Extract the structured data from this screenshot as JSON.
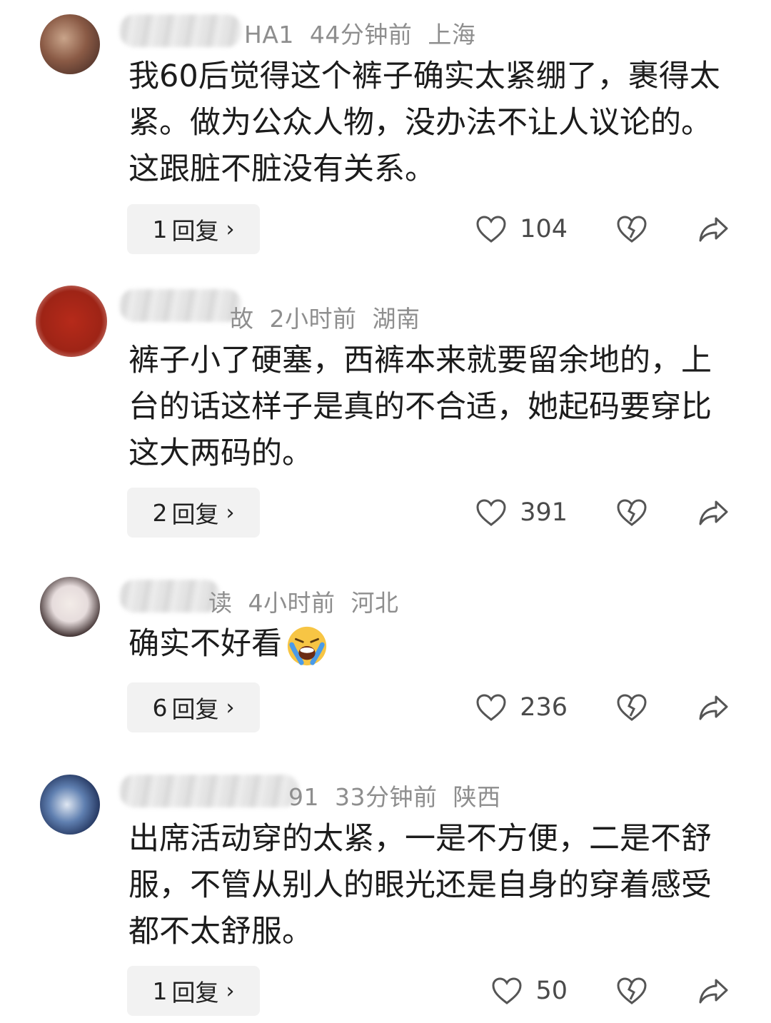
{
  "comments": [
    {
      "name_suffix": "HA1",
      "time": "44分钟前",
      "location": "上海",
      "text": "我60后觉得这个裤子确实太紧绷了，裹得太紧。做为公众人物，没办法不让人议论的。这跟脏不脏没有关系。",
      "reply_count": "1",
      "reply_label": "回复",
      "likes": "104"
    },
    {
      "name_suffix": "故",
      "time": "2小时前",
      "location": "湖南",
      "text": "裤子小了硬塞，西裤本来就要留余地的，上台的话这样子是真的不合适，她起码要穿比这大两码的。",
      "reply_count": "2",
      "reply_label": "回复",
      "likes": "391"
    },
    {
      "name_suffix": "读",
      "time": "4小时前",
      "location": "河北",
      "text": "确实不好看",
      "reply_count": "6",
      "reply_label": "回复",
      "likes": "236"
    },
    {
      "name_suffix": "91",
      "time": "33分钟前",
      "location": "陕西",
      "text": "出席活动穿的太紧，一是不方便，二是不舒服，不管从别人的眼光还是自身的穿着感受都不太舒服。",
      "reply_count": "1",
      "reply_label": "回复",
      "likes": "50"
    }
  ],
  "icons": {
    "like": "heart-outline-icon",
    "dislike": "broken-heart-icon",
    "share": "share-arrow-icon",
    "emoji": "crying-laughing-emoji"
  },
  "colors": {
    "meta_text": "#8e8e8e",
    "body_text": "#1c1c1c",
    "reply_button_bg": "#f2f2f2"
  }
}
